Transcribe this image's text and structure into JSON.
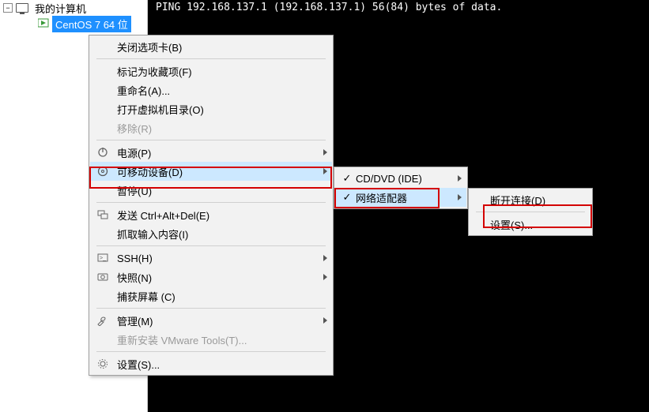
{
  "tree": {
    "root_label": "我的计算机",
    "vm_label": "CentOS 7 64 位"
  },
  "terminal": {
    "line1": "PING 192.168.137.1 (192.168.137.1) 56(84) bytes of data."
  },
  "menu1": {
    "close_tab": "关闭选项卡(B)",
    "favorite": "标记为收藏项(F)",
    "rename": "重命名(A)...",
    "open_dir": "打开虚拟机目录(O)",
    "remove": "移除(R)",
    "power": "电源(P)",
    "removable": "可移动设备(D)",
    "pause": "暂停(U)",
    "send_cad": "发送 Ctrl+Alt+Del(E)",
    "grab_input": "抓取输入内容(I)",
    "ssh": "SSH(H)",
    "snapshot": "快照(N)",
    "capture": "捕获屏幕 (C)",
    "manage": "管理(M)",
    "reinstall_tools": "重新安装 VMware Tools(T)...",
    "settings": "设置(S)..."
  },
  "menu2": {
    "cddvd": "CD/DVD (IDE)",
    "netadapter": "网络适配器"
  },
  "menu3": {
    "disconnect": "断开连接(D)",
    "settings": "设置(S)..."
  }
}
